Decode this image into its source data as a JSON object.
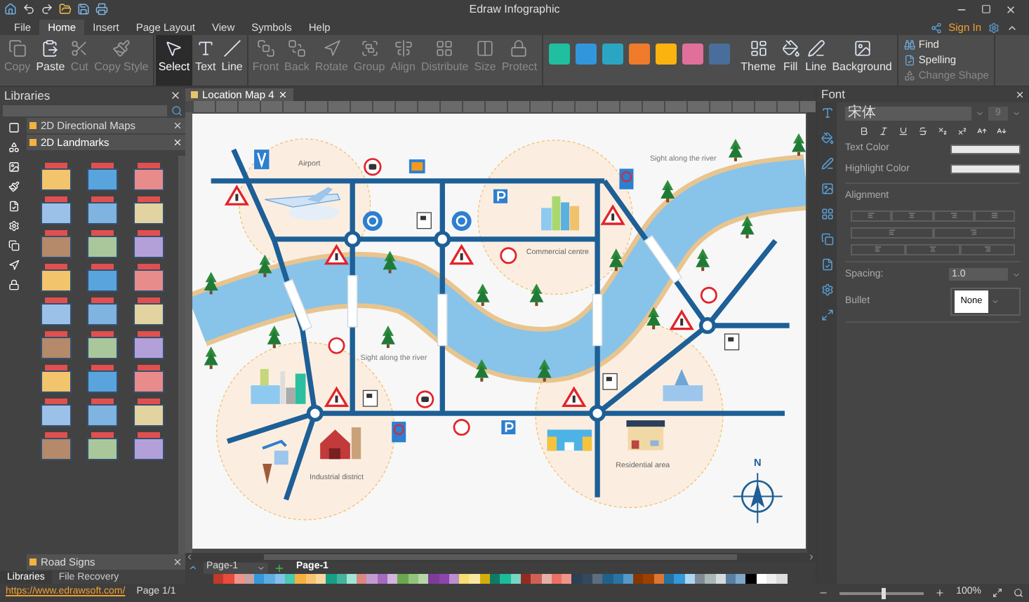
{
  "title_bar": {
    "title": "Edraw Infographic"
  },
  "menu": {
    "items": [
      {
        "label": "File",
        "selected": false
      },
      {
        "label": "Home",
        "selected": true
      },
      {
        "label": "Insert",
        "selected": false
      },
      {
        "label": "Page Layout",
        "selected": false
      },
      {
        "label": "View",
        "selected": false
      },
      {
        "label": "Symbols",
        "selected": false
      },
      {
        "label": "Help",
        "selected": false
      }
    ],
    "sign_in": "Sign In"
  },
  "ribbon": {
    "clipboard": [
      {
        "label": "Copy",
        "disabled": true
      },
      {
        "label": "Paste",
        "disabled": false
      },
      {
        "label": "Cut",
        "disabled": true
      },
      {
        "label": "Copy Style",
        "disabled": true
      }
    ],
    "tools": [
      {
        "label": "Select",
        "selected": true
      },
      {
        "label": "Text",
        "selected": false
      },
      {
        "label": "Line",
        "selected": false
      }
    ],
    "arrange": [
      {
        "label": "Front",
        "disabled": true
      },
      {
        "label": "Back",
        "disabled": true
      },
      {
        "label": "Rotate",
        "disabled": true
      },
      {
        "label": "Group",
        "disabled": true
      },
      {
        "label": "Align",
        "disabled": true
      },
      {
        "label": "Distribute",
        "disabled": true
      },
      {
        "label": "Size",
        "disabled": true
      },
      {
        "label": "Protect",
        "disabled": true
      }
    ],
    "styles": [
      {
        "color": "#1fbf9f"
      },
      {
        "color": "#3296dc"
      },
      {
        "color": "#2ba6c2"
      },
      {
        "color": "#f07b2b"
      },
      {
        "color": "#fbb40f"
      },
      {
        "color": "#e0709a"
      },
      {
        "color": "#4a6e9c"
      }
    ],
    "design": [
      {
        "label": "Theme"
      },
      {
        "label": "Fill"
      },
      {
        "label": "Line"
      },
      {
        "label": "Background"
      }
    ],
    "editing": [
      {
        "label": "Find",
        "disabled": false
      },
      {
        "label": "Spelling",
        "disabled": false
      },
      {
        "label": "Change Shape",
        "disabled": true
      }
    ]
  },
  "libraries": {
    "title": "Libraries",
    "sections": [
      {
        "label": "2D Directional Maps",
        "expanded": false
      },
      {
        "label": "2D Landmarks",
        "expanded": true
      },
      {
        "label": "Road Signs",
        "expanded": false
      }
    ],
    "tabs": [
      {
        "label": "Libraries",
        "selected": true
      },
      {
        "label": "File Recovery",
        "selected": false
      }
    ]
  },
  "document_tab": {
    "label": "Location Map 4"
  },
  "map": {
    "zones": [
      {
        "label": "Airport"
      },
      {
        "label": "Commercial centre"
      },
      {
        "label": "Industrial district"
      },
      {
        "label": "Residential area"
      }
    ],
    "river_labels": [
      "Sight along the river",
      "Sight along the river"
    ],
    "compass": {
      "label": "N"
    }
  },
  "font_panel": {
    "title": "Font",
    "font_name": "宋体",
    "font_size": "9",
    "text_color_label": "Text Color",
    "highlight_color_label": "Highlight Color",
    "alignment_label": "Alignment",
    "spacing_label": "Spacing:",
    "spacing": "1.0",
    "bullet_label": "Bullet",
    "bullet": "None"
  },
  "page_tabs": {
    "dropdown": "Page-1",
    "tabs": [
      {
        "label": "Page-1",
        "selected": true
      }
    ]
  },
  "status_bar": {
    "link": "https://www.edrawsoft.com/",
    "page": "Page 1/1",
    "zoom": "100%",
    "zoom_slider": {
      "level": 0.5
    }
  }
}
